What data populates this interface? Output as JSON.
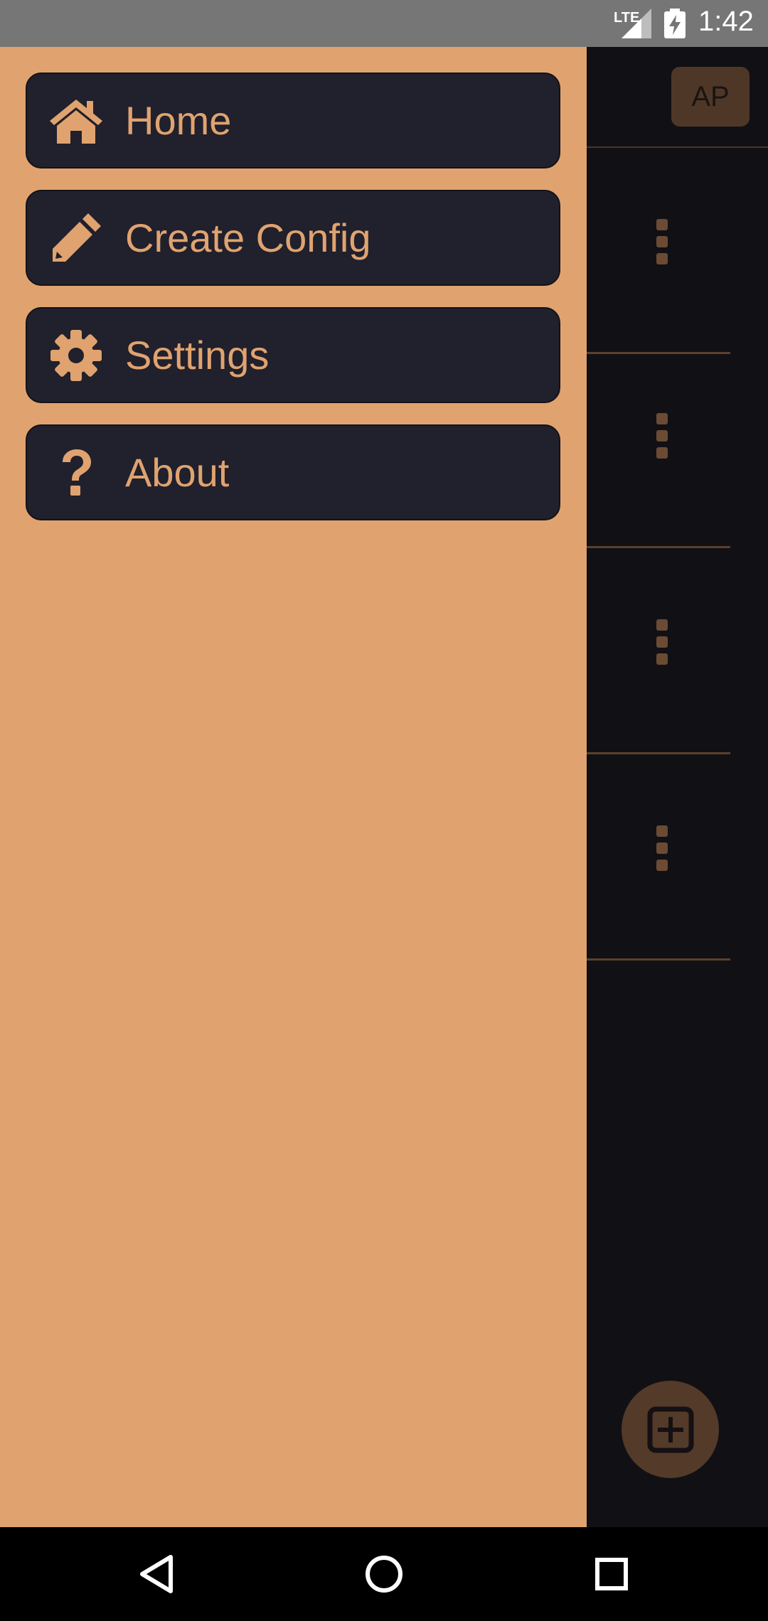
{
  "status_bar": {
    "network_label": "LTE",
    "time": "1:42"
  },
  "header": {
    "avatar_initials": "AP"
  },
  "drawer": {
    "items": [
      {
        "label": "Home",
        "icon": "home-icon"
      },
      {
        "label": "Create Config",
        "icon": "pencil-icon"
      },
      {
        "label": "Settings",
        "icon": "gear-icon"
      },
      {
        "label": "About",
        "icon": "question-icon"
      }
    ]
  },
  "fab": {
    "icon": "add-square-icon"
  },
  "nav_bar": {
    "icons": [
      "back-icon",
      "home-circle-icon",
      "recents-icon"
    ]
  },
  "colors": {
    "drawer_bg": "#e0a36f",
    "menu_item_bg": "#21202d",
    "app_bg": "#111015",
    "accent_brown": "#543a28"
  }
}
